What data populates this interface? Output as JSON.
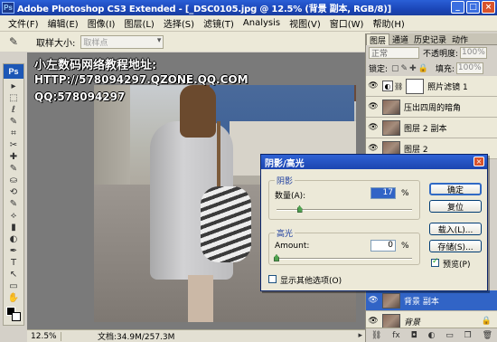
{
  "window": {
    "app_badge": "Ps",
    "title": "Adobe Photoshop CS3 Extended - [_DSC0105.jpg @ 12.5% (背景 副本, RGB/8)]",
    "controls": [
      "_",
      "□",
      "×"
    ]
  },
  "menu": [
    "文件(F)",
    "编辑(E)",
    "图像(I)",
    "图层(L)",
    "选择(S)",
    "滤镜(T)",
    "Analysis",
    "视图(V)",
    "窗口(W)",
    "帮助(H)"
  ],
  "options": {
    "tool_icon": "eyedropper-icon",
    "sample_size_label": "取样大小:",
    "sample_size_value": "取样点"
  },
  "toolbox": {
    "logo": "Ps",
    "tools": [
      "▸",
      "⬚",
      "ℓ",
      "✎",
      "⌗",
      "✂",
      "✚",
      "✎",
      "⛀",
      "⟲",
      "✎",
      "⟡",
      "▮",
      "◐",
      "✒",
      "T",
      "↖",
      "▭",
      "✋",
      "🔍"
    ]
  },
  "overlay": {
    "line1": "小左数码网络教程地址:",
    "line2": "HTTP://578094297.QZONE.QQ.COM",
    "line3": "QQ:578094297"
  },
  "status": {
    "zoom": "12.5%",
    "doc": "文档:34.9M/257.3M"
  },
  "layers_panel": {
    "tabs": [
      "图层",
      "通道",
      "历史记录",
      "动作"
    ],
    "active_tab": "图层",
    "blend_mode": "正常",
    "opacity_label": "不透明度:",
    "opacity_value": "100%",
    "lock_label": "锁定:",
    "fill_label": "填充:",
    "fill_value": "100%",
    "layers": [
      {
        "name": "照片滤镜 1",
        "type": "adjustment",
        "selected": false
      },
      {
        "name": "压出四周的暗角",
        "type": "image",
        "selected": false
      },
      {
        "name": "图层 2 副本",
        "type": "image",
        "selected": false
      },
      {
        "name": "图层 2",
        "type": "image",
        "selected": false
      },
      {
        "name": "背景 副本",
        "type": "image",
        "selected": true
      },
      {
        "name": "背景",
        "type": "image",
        "selected": false,
        "locked": true
      }
    ],
    "footer_icons": [
      "link-icon",
      "fx-icon",
      "mask-icon",
      "adjustment-icon",
      "folder-icon",
      "new-layer-icon",
      "trash-icon"
    ]
  },
  "dialog": {
    "title": "阴影/高光",
    "close": "×",
    "shadows": {
      "group_label": "阴影",
      "amount_label": "数量(A):",
      "amount_value": "17",
      "amount_fraction": 0.17,
      "unit": "%"
    },
    "highlights": {
      "group_label": "高光",
      "amount_label": "Amount:",
      "amount_value": "0",
      "amount_fraction": 0.0,
      "unit": "%"
    },
    "show_more_label": "显示其他选项(O)",
    "show_more_checked": false,
    "buttons": {
      "ok": "确定",
      "reset": "复位",
      "load": "载入(L)...",
      "save": "存储(S)..."
    },
    "preview_label": "预览(P)",
    "preview_checked": true
  }
}
